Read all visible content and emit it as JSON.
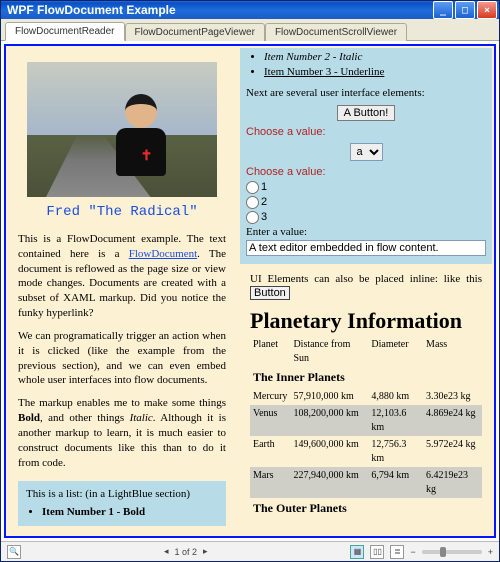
{
  "window": {
    "title": "WPF FlowDocument Example"
  },
  "winbtns": {
    "min": "_",
    "max": "□",
    "close": "×"
  },
  "tabs": [
    {
      "label": "FlowDocumentReader",
      "active": true
    },
    {
      "label": "FlowDocumentPageViewer",
      "active": false
    },
    {
      "label": "FlowDocumentScrollViewer",
      "active": false
    }
  ],
  "caption": "Fred \"The Radical\"",
  "paragraphs": {
    "p1_a": "This is a FlowDocument example. The text contained here is a ",
    "p1_link": "FlowDocument",
    "p1_b": ". The document is reflowed as the page size or view mode changes. Documents are created with a subset of XAML markup. Did you notice the funky hyperlink?",
    "p2": "We can programatically trigger an action when it is clicked (like the example from the previous section), and we can even embed whole user interfaces into flow documents.",
    "p3_a": "The markup enables me to make some things ",
    "p3_bold": "Bold",
    "p3_b": ", and other things ",
    "p3_ital": "Italic",
    "p3_c": ". Although it is another markup to learn, it is much easier to construct documents like this than to do it from code."
  },
  "listSection": {
    "intro": "This is a list: (in a LightBlue section)",
    "items": [
      "Item Number 1 - Bold",
      "Item Number 2 - Italic",
      "Item Number 3 - Underline"
    ]
  },
  "uiIntro": "Next are several user interface elements:",
  "button1": "A Button!",
  "choose": "Choose a value:",
  "comboValue": "a",
  "radios": [
    "1",
    "2",
    "3"
  ],
  "enter": "Enter a value:",
  "editorValue": "A text editor embedded in flow content.",
  "inlineText_a": "UI Elements can also be placed inline: like this ",
  "inlineBtn": "Button",
  "planetTitle": "Planetary Information",
  "table": {
    "headers": [
      "Planet",
      "Distance from Sun",
      "Diameter",
      "Mass"
    ],
    "innerHeader": "The Inner Planets",
    "inner": [
      [
        "Mercury",
        "57,910,000 km",
        "4,880 km",
        "3.30e23 kg"
      ],
      [
        "Venus",
        "108,200,000 km",
        "12,103.6 km",
        "4.869e24 kg"
      ],
      [
        "Earth",
        "149,600,000 km",
        "12,756.3 km",
        "5.972e24 kg"
      ],
      [
        "Mars",
        "227,940,000 km",
        "6,794 km",
        "6.4219e23 kg"
      ]
    ],
    "outerHeader": "The Outer Planets"
  },
  "toolbar": {
    "search": "🔍",
    "pageText": "1 of 2",
    "arrowL": "◂",
    "arrowR": "▸",
    "viewIcons": [
      "▦",
      "▯▯",
      "≣"
    ],
    "minus": "−",
    "plus": "+"
  }
}
